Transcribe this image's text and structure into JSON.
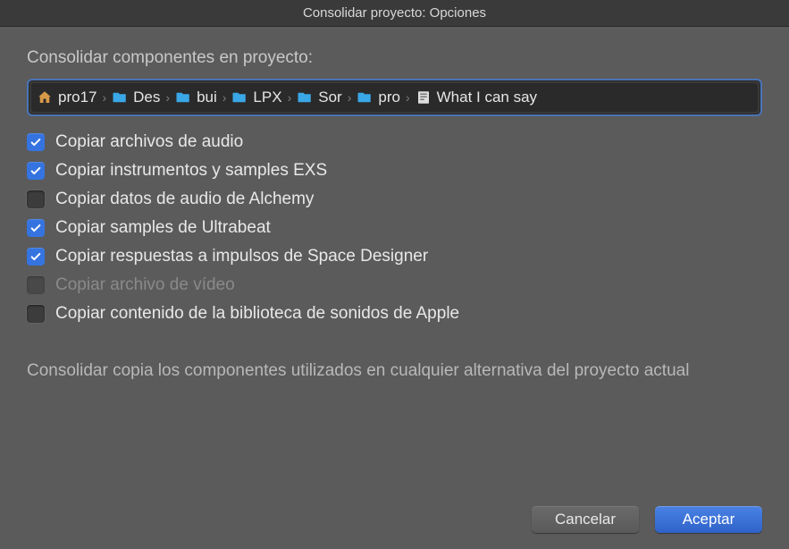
{
  "title": "Consolidar proyecto: Opciones",
  "section_label": "Consolidar componentes en proyecto:",
  "breadcrumb": [
    {
      "icon": "home",
      "label": "pro17"
    },
    {
      "icon": "folder",
      "label": "Des"
    },
    {
      "icon": "folder",
      "label": "bui"
    },
    {
      "icon": "folder",
      "label": "LPX"
    },
    {
      "icon": "folder",
      "label": "Sor"
    },
    {
      "icon": "folder",
      "label": "pro"
    },
    {
      "icon": "project",
      "label": "What I can say"
    }
  ],
  "options": [
    {
      "label": "Copiar archivos de audio",
      "checked": true,
      "disabled": false
    },
    {
      "label": "Copiar instrumentos y samples EXS",
      "checked": true,
      "disabled": false
    },
    {
      "label": "Copiar datos de audio de Alchemy",
      "checked": false,
      "disabled": false
    },
    {
      "label": "Copiar samples de Ultrabeat",
      "checked": true,
      "disabled": false
    },
    {
      "label": "Copiar respuestas a impulsos de Space Designer",
      "checked": true,
      "disabled": false
    },
    {
      "label": "Copiar archivo de vídeo",
      "checked": false,
      "disabled": true
    },
    {
      "label": "Copiar contenido de la biblioteca de sonidos de Apple",
      "checked": false,
      "disabled": false
    }
  ],
  "footer_text": "Consolidar copia los componentes utilizados en cualquier alternativa del proyecto actual",
  "buttons": {
    "cancel": "Cancelar",
    "ok": "Aceptar"
  }
}
